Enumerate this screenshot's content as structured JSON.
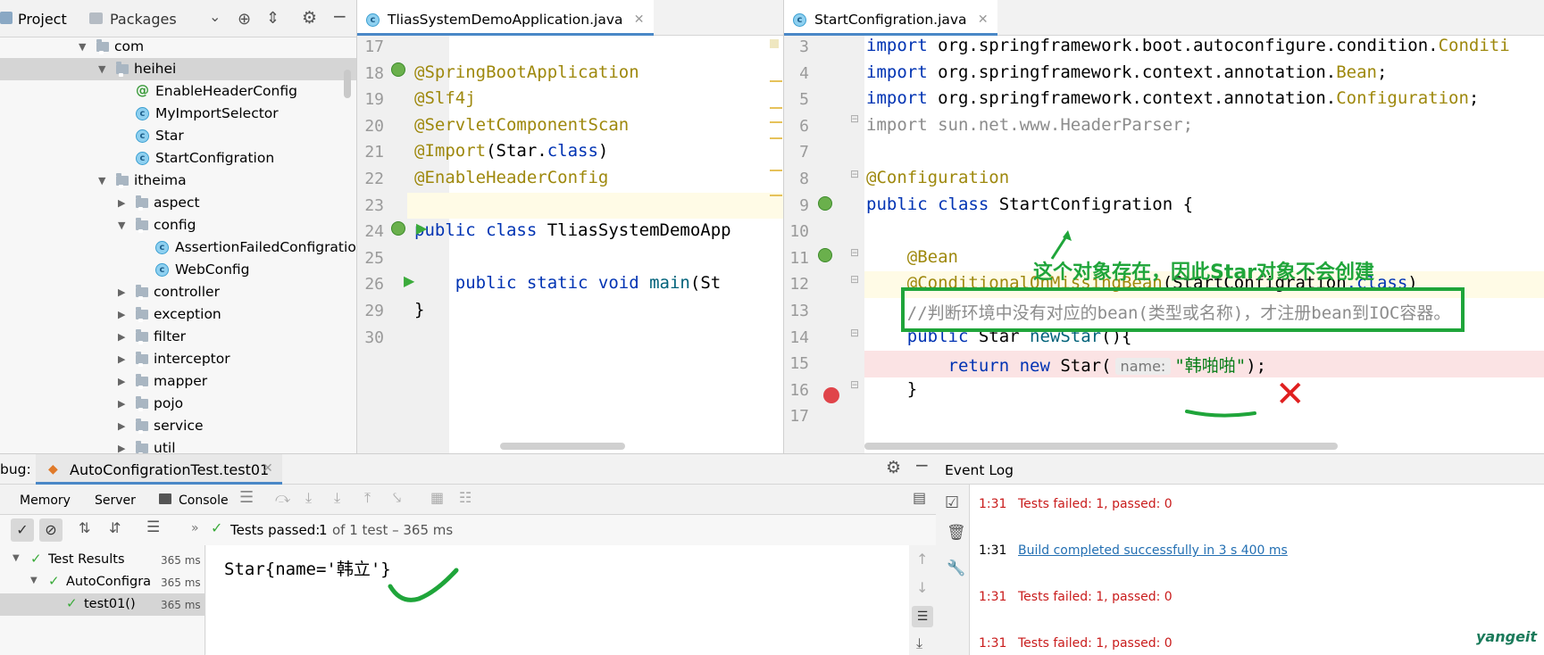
{
  "project_panel": {
    "tab_project": "Project",
    "tab_packages": "Packages",
    "tree": [
      {
        "label": "com",
        "type": "folder",
        "level": 0,
        "expanded": true
      },
      {
        "label": "heihei",
        "type": "folder",
        "level": 1,
        "expanded": true,
        "selected": true
      },
      {
        "label": "EnableHeaderConfig",
        "type": "annotation",
        "level": 2
      },
      {
        "label": "MyImportSelector",
        "type": "class",
        "level": 2
      },
      {
        "label": "Star",
        "type": "class",
        "level": 2
      },
      {
        "label": "StartConfigration",
        "type": "class",
        "level": 2
      },
      {
        "label": "itheima",
        "type": "folder",
        "level": 1,
        "expanded": true
      },
      {
        "label": "aspect",
        "type": "folder",
        "level": 2,
        "expanded": false
      },
      {
        "label": "config",
        "type": "folder",
        "level": 2,
        "expanded": true
      },
      {
        "label": "AssertionFailedConfigration",
        "type": "class",
        "level": 3
      },
      {
        "label": "WebConfig",
        "type": "class",
        "level": 3
      },
      {
        "label": "controller",
        "type": "folder",
        "level": 2,
        "expanded": false
      },
      {
        "label": "exception",
        "type": "folder",
        "level": 2,
        "expanded": false
      },
      {
        "label": "filter",
        "type": "folder",
        "level": 2,
        "expanded": false
      },
      {
        "label": "interceptor",
        "type": "folder",
        "level": 2,
        "expanded": false
      },
      {
        "label": "mapper",
        "type": "folder",
        "level": 2,
        "expanded": false
      },
      {
        "label": "pojo",
        "type": "folder",
        "level": 2,
        "expanded": false
      },
      {
        "label": "service",
        "type": "folder",
        "level": 2,
        "expanded": false
      },
      {
        "label": "util",
        "type": "folder",
        "level": 2,
        "expanded": false
      }
    ]
  },
  "editor1": {
    "tab_label": "TliasSystemDemoApplication.java",
    "lines": [
      {
        "num": "17",
        "tokens": []
      },
      {
        "num": "18",
        "tokens": [
          {
            "t": "@SpringBootApplication",
            "c": "ann"
          }
        ]
      },
      {
        "num": "19",
        "tokens": [
          {
            "t": "@Slf4j",
            "c": "ann"
          }
        ]
      },
      {
        "num": "20",
        "tokens": [
          {
            "t": "@ServletComponentScan",
            "c": "ann"
          }
        ]
      },
      {
        "num": "21",
        "tokens": [
          {
            "t": "@Import",
            "c": "ann"
          },
          {
            "t": "(Star.",
            "c": ""
          },
          {
            "t": "class",
            "c": "kw"
          },
          {
            "t": ")",
            "c": ""
          }
        ]
      },
      {
        "num": "22",
        "tokens": [
          {
            "t": "@EnableHeaderConfig",
            "c": "ann"
          }
        ]
      },
      {
        "num": "23",
        "tokens": []
      },
      {
        "num": "24",
        "tokens": [
          {
            "t": "public class ",
            "c": "kw"
          },
          {
            "t": "TliasSystemDemoApp",
            "c": ""
          }
        ]
      },
      {
        "num": "25",
        "tokens": []
      },
      {
        "num": "26",
        "tokens": [
          {
            "t": "    public static void ",
            "c": "kw"
          },
          {
            "t": "main",
            "c": "mth"
          },
          {
            "t": "(St",
            "c": ""
          }
        ]
      },
      {
        "num": "29",
        "tokens": [
          {
            "t": "}",
            "c": ""
          }
        ]
      },
      {
        "num": "30",
        "tokens": []
      }
    ]
  },
  "editor2": {
    "tab_label": "StartConfigration.java",
    "lines": [
      {
        "num": "3",
        "tokens": [
          {
            "t": "import ",
            "c": "kw"
          },
          {
            "t": "org.springframework.boot.autoconfigure.condition.",
            "c": ""
          },
          {
            "t": "Conditi",
            "c": "ann"
          }
        ]
      },
      {
        "num": "4",
        "tokens": [
          {
            "t": "import ",
            "c": "kw"
          },
          {
            "t": "org.springframework.context.annotation.",
            "c": ""
          },
          {
            "t": "Bean",
            "c": "ann"
          },
          {
            "t": ";",
            "c": ""
          }
        ]
      },
      {
        "num": "5",
        "tokens": [
          {
            "t": "import ",
            "c": "kw"
          },
          {
            "t": "org.springframework.context.annotation.",
            "c": ""
          },
          {
            "t": "Configuration",
            "c": "ann"
          },
          {
            "t": ";",
            "c": ""
          }
        ]
      },
      {
        "num": "6",
        "tokens": [
          {
            "t": "import sun.net.www.HeaderParser;",
            "c": "grey"
          }
        ]
      },
      {
        "num": "7",
        "tokens": []
      },
      {
        "num": "8",
        "tokens": [
          {
            "t": "@Configuration",
            "c": "ann"
          }
        ]
      },
      {
        "num": "9",
        "tokens": [
          {
            "t": "public class ",
            "c": "kw"
          },
          {
            "t": "StartConfigration",
            "c": ""
          },
          {
            "t": " {",
            "c": ""
          }
        ]
      },
      {
        "num": "10",
        "tokens": []
      },
      {
        "num": "11",
        "tokens": [
          {
            "t": "    @Bean",
            "c": "ann"
          }
        ]
      },
      {
        "num": "12",
        "tokens": [
          {
            "t": "    @ConditionalOnMissingBean",
            "c": "ann"
          },
          {
            "t": "(StartConfigration",
            "c": ""
          },
          {
            "t": ".class",
            "c": "kw"
          },
          {
            "t": ")",
            "c": ""
          }
        ]
      },
      {
        "num": "13",
        "tokens": [
          {
            "t": "    //判断环境中没有对应的bean(类型或名称)，才注册bean到IOC容器。",
            "c": "grey"
          }
        ]
      },
      {
        "num": "14",
        "tokens": [
          {
            "t": "    public ",
            "c": "kw"
          },
          {
            "t": "Star ",
            "c": ""
          },
          {
            "t": "newStar",
            "c": "mth"
          },
          {
            "t": "(){",
            "c": ""
          }
        ]
      },
      {
        "num": "15",
        "tokens": [
          {
            "t": "        return new ",
            "c": "kw"
          },
          {
            "t": "Star(",
            "c": ""
          }
        ]
      },
      {
        "num": "16",
        "tokens": [
          {
            "t": "    }",
            "c": ""
          }
        ]
      },
      {
        "num": "17",
        "tokens": []
      }
    ],
    "param_hint": "name:",
    "string_literal": "\"韩啪啪\"",
    "string_tail": ");",
    "annotation_note": "这个对象存在，因此Star对象不会创建"
  },
  "debug": {
    "title": "bug:",
    "session_tab": "AutoConfigrationTest.test01",
    "subtabs": [
      "Memory",
      "Server",
      "Console"
    ],
    "status_prefix": "Tests passed:",
    "status_count": "1",
    "status_suffix": "of 1 test – 365 ms",
    "tree": [
      {
        "label": "Test Results",
        "time": "365 ms",
        "level": 0
      },
      {
        "label": "AutoConfigra",
        "time": "365 ms",
        "level": 1
      },
      {
        "label": "test01()",
        "time": "365 ms",
        "level": 2,
        "selected": true
      }
    ],
    "output": "Star{name='韩立'}"
  },
  "event_log": {
    "title": "Event Log",
    "entries": [
      {
        "time": "1:31",
        "text": "Tests failed: 1, passed: 0",
        "kind": "error"
      },
      {
        "time": "1:31",
        "text": "Build completed successfully in 3 s 400 ms",
        "kind": "link"
      },
      {
        "time": "1:31",
        "text": "Tests failed: 1, passed: 0",
        "kind": "error"
      },
      {
        "time": "1:31",
        "text": "Tests failed: 1, passed: 0",
        "kind": "error"
      }
    ],
    "watermark": "yangeit"
  },
  "colors": {
    "annotation_box": "#1fa53a",
    "error_text": "#c91b1b",
    "link": "#2470b3",
    "breakpoint": "#e0444a",
    "check_green": "#3bab3b"
  }
}
